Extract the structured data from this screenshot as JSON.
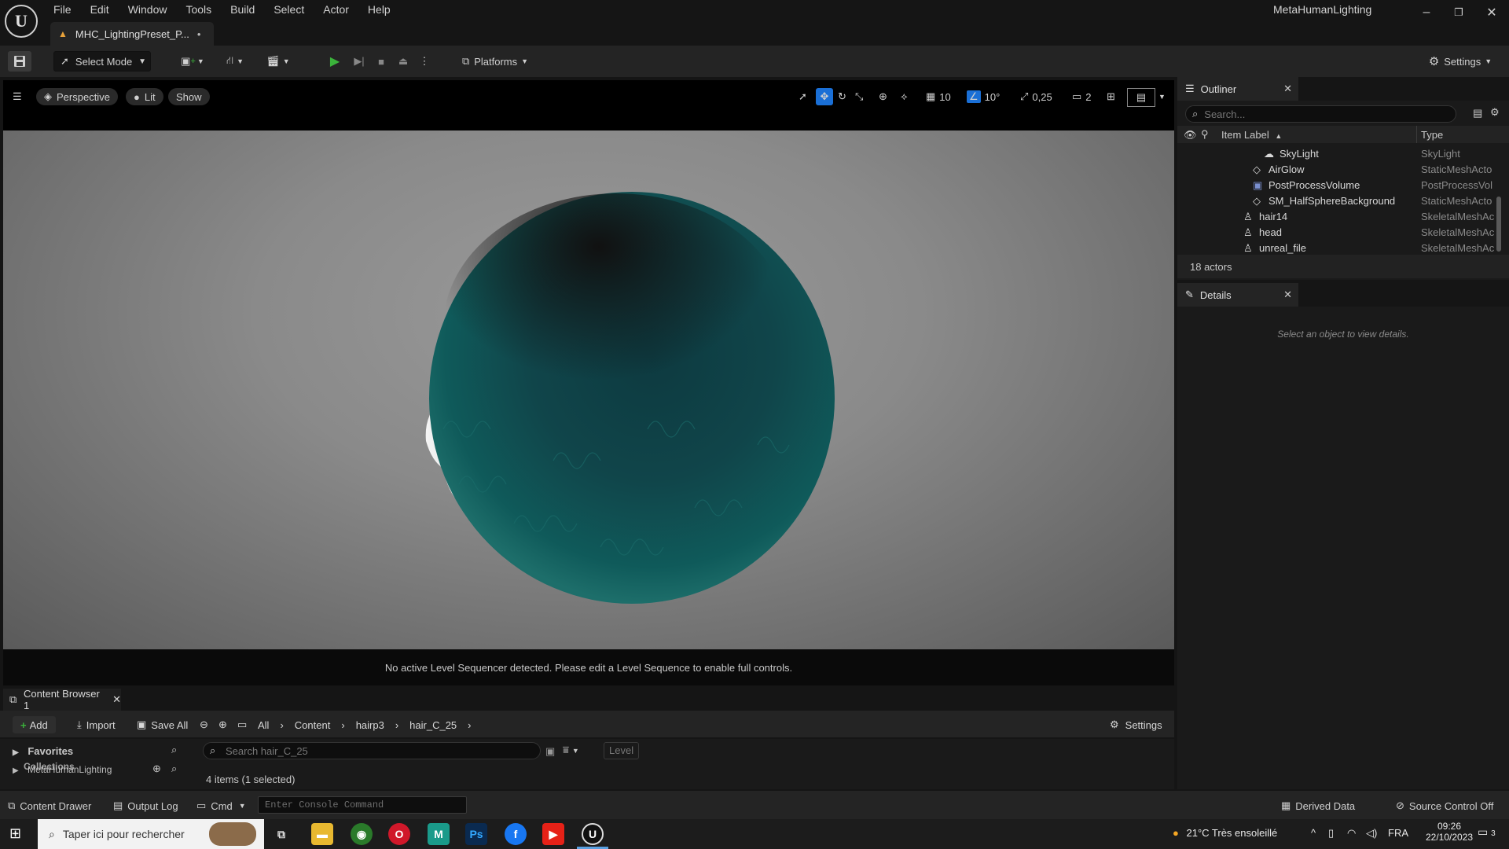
{
  "menu": [
    "File",
    "Edit",
    "Window",
    "Tools",
    "Build",
    "Select",
    "Actor",
    "Help"
  ],
  "document_tab": {
    "label": "MHC_LightingPreset_P...",
    "modified": "•"
  },
  "app_title": "MetaHumanLighting",
  "toolbar": {
    "select_mode": "Select Mode",
    "platforms": "Platforms",
    "settings": "Settings"
  },
  "viewport": {
    "perspective": "Perspective",
    "lit": "Lit",
    "show": "Show",
    "grid_snap": "10",
    "rotation_snap": "10°",
    "scale_snap": "0,25",
    "camera_speed": "2",
    "sequencer_message": "No active Level Sequencer detected. Please edit a Level Sequence to enable full controls."
  },
  "outliner": {
    "tab": "Outliner",
    "search_placeholder": "Search...",
    "col_label": "Item Label",
    "col_type": "Type",
    "rows": [
      {
        "label": "SkyLight",
        "type": "SkyLight",
        "icon": "skylight-icon"
      },
      {
        "label": "AirGlow",
        "type": "StaticMeshActo",
        "icon": "static-mesh-icon"
      },
      {
        "label": "PostProcessVolume",
        "type": "PostProcessVol",
        "icon": "volume-icon"
      },
      {
        "label": "SM_HalfSphereBackground",
        "type": "StaticMeshActo",
        "icon": "static-mesh-icon"
      },
      {
        "label": "hair14",
        "type": "SkeletalMeshAc",
        "icon": "skeletal-mesh-icon"
      },
      {
        "label": "head",
        "type": "SkeletalMeshAc",
        "icon": "skeletal-mesh-icon"
      },
      {
        "label": "unreal_file",
        "type": "SkeletalMeshAc",
        "icon": "skeletal-mesh-icon"
      }
    ],
    "count": "18 actors"
  },
  "details": {
    "tab": "Details",
    "empty_message": "Select an object to view details."
  },
  "content_browser": {
    "tab": "Content Browser 1",
    "add": "Add",
    "import": "Import",
    "save_all": "Save All",
    "path": [
      "All",
      "Content",
      "hairp3",
      "hair_C_25"
    ],
    "settings": "Settings",
    "favorites": "Favorites",
    "root_folder": "MetaHumanLighting",
    "collections": "Collections",
    "search_placeholder": "Search hair_C_25",
    "level_filter": "Level",
    "item_count": "4 items (1 selected)"
  },
  "statusbar": {
    "content_drawer": "Content Drawer",
    "output_log": "Output Log",
    "cmd": "Cmd",
    "console_placeholder": "Enter Console Command",
    "derived_data": "Derived Data",
    "source_control": "Source Control Off"
  },
  "taskbar": {
    "search_placeholder": "Taper ici pour rechercher",
    "weather": "21°C  Très ensoleillé",
    "language": "FRA",
    "time": "09:26",
    "date": "22/10/2023",
    "notifications": "3"
  },
  "colors": {
    "accent_blue": "#1a6fd6",
    "play_green": "#3bb33b",
    "hair_teal": "#0f5a5a"
  }
}
